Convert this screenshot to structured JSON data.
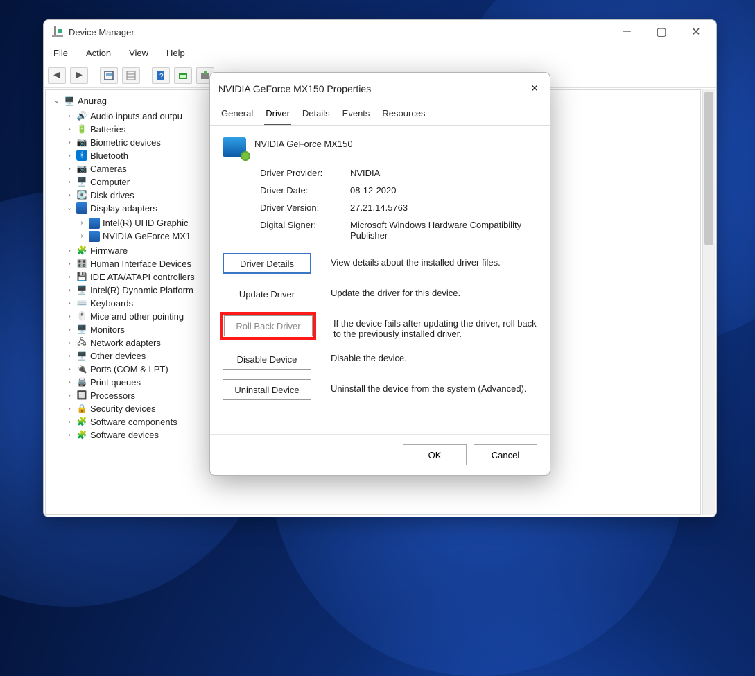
{
  "dm": {
    "title": "Device Manager",
    "menus": [
      "File",
      "Action",
      "View",
      "Help"
    ],
    "root": "Anurag",
    "nodes": [
      {
        "icon": "i-audio",
        "label": "Audio inputs and outpu"
      },
      {
        "icon": "i-battery",
        "label": "Batteries"
      },
      {
        "icon": "i-finger",
        "label": "Biometric devices"
      },
      {
        "icon": "i-bt",
        "label": "Bluetooth"
      },
      {
        "icon": "i-camera",
        "label": "Cameras"
      },
      {
        "icon": "i-computer",
        "label": "Computer"
      },
      {
        "icon": "i-disk",
        "label": "Disk drives"
      },
      {
        "icon": "i-display",
        "label": "Display adapters",
        "children": [
          {
            "icon": "i-display",
            "label": "Intel(R) UHD Graphic"
          },
          {
            "icon": "i-display",
            "label": "NVIDIA GeForce MX1"
          }
        ]
      },
      {
        "icon": "i-firmware",
        "label": "Firmware"
      },
      {
        "icon": "i-hid",
        "label": "Human Interface Devices"
      },
      {
        "icon": "i-ide",
        "label": "IDE ATA/ATAPI controllers"
      },
      {
        "icon": "i-dyn",
        "label": "Intel(R) Dynamic Platform"
      },
      {
        "icon": "i-kbd",
        "label": "Keyboards"
      },
      {
        "icon": "i-mouse",
        "label": "Mice and other pointing"
      },
      {
        "icon": "i-monitor",
        "label": "Monitors"
      },
      {
        "icon": "i-net",
        "label": "Network adapters"
      },
      {
        "icon": "i-other",
        "label": "Other devices"
      },
      {
        "icon": "i-port",
        "label": "Ports (COM & LPT)"
      },
      {
        "icon": "i-print",
        "label": "Print queues"
      },
      {
        "icon": "i-cpu",
        "label": "Processors"
      },
      {
        "icon": "i-sec",
        "label": "Security devices"
      },
      {
        "icon": "i-soft",
        "label": "Software components"
      },
      {
        "icon": "i-soft",
        "label": "Software devices"
      }
    ]
  },
  "props": {
    "title": "NVIDIA GeForce MX150 Properties",
    "tabs": [
      "General",
      "Driver",
      "Details",
      "Events",
      "Resources"
    ],
    "active_tab": 1,
    "device_name": "NVIDIA GeForce MX150",
    "info": {
      "provider_lbl": "Driver Provider:",
      "provider": "NVIDIA",
      "date_lbl": "Driver Date:",
      "date": "08-12-2020",
      "version_lbl": "Driver Version:",
      "version": "27.21.14.5763",
      "signer_lbl": "Digital Signer:",
      "signer": "Microsoft Windows Hardware Compatibility Publisher"
    },
    "actions": {
      "details": {
        "btn": "Driver Details",
        "desc": "View details about the installed driver files."
      },
      "update": {
        "btn": "Update Driver",
        "desc": "Update the driver for this device."
      },
      "rollback": {
        "btn": "Roll Back Driver",
        "desc": "If the device fails after updating the driver, roll back to the previously installed driver."
      },
      "disable": {
        "btn": "Disable Device",
        "desc": "Disable the device."
      },
      "uninstall": {
        "btn": "Uninstall Device",
        "desc": "Uninstall the device from the system (Advanced)."
      }
    },
    "ok": "OK",
    "cancel": "Cancel"
  }
}
